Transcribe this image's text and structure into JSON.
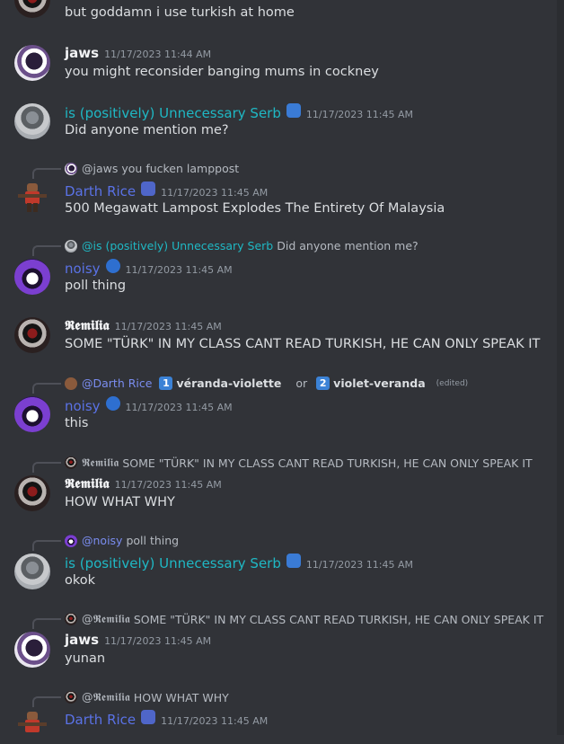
{
  "messages": [
    {
      "content": "but goddamn i use turkish at home"
    },
    {
      "author": "jaws",
      "timestamp": "11/17/2023 11:44 AM",
      "content": "you might reconsider banging mums in cockney"
    },
    {
      "author": "is (positively) Unnecessary Serb",
      "timestamp": "11/17/2023 11:45 AM",
      "content": "Did anyone mention me?"
    },
    {
      "reply_to": {
        "mention": "@jaws",
        "text": "you fucken lamppost"
      },
      "author": "Darth Rice",
      "timestamp": "11/17/2023 11:45 AM",
      "content": "500 Megawatt Lampost Explodes The Entirety Of Malaysia"
    },
    {
      "reply_to": {
        "mention": "@is (positively) Unnecessary Serb",
        "text": "Did anyone mention me?"
      },
      "author": "noisy",
      "timestamp": "11/17/2023 11:45 AM",
      "content": "poll thing"
    },
    {
      "author": "𝕽𝖊𝖒𝖎𝖑𝖎𝖆",
      "timestamp": "11/17/2023 11:45 AM",
      "content": "SOME \"TÜRK\" IN MY CLASS CANT READ TURKISH, HE CAN ONLY SPEAK IT"
    },
    {
      "reply_to": {
        "mention": "@Darth Rice",
        "poll": {
          "opt1_num": "1",
          "opt1": "véranda-violette",
          "or": "or",
          "opt2_num": "2",
          "opt2": "violet-veranda",
          "edited": "(edited)"
        }
      },
      "author": "noisy",
      "timestamp": "11/17/2023 11:45 AM",
      "content": "this"
    },
    {
      "reply_to": {
        "mention": "𝕽𝖊𝖒𝖎𝖑𝖎𝖆",
        "text": "SOME \"TÜRK\" IN MY CLASS CANT READ TURKISH, HE CAN ONLY SPEAK IT"
      },
      "author": "𝕽𝖊𝖒𝖎𝖑𝖎𝖆",
      "timestamp": "11/17/2023 11:45 AM",
      "content": "HOW WHAT WHY"
    },
    {
      "reply_to": {
        "mention": "@noisy",
        "text": "poll thing"
      },
      "author": "is (positively) Unnecessary Serb",
      "timestamp": "11/17/2023 11:45 AM",
      "content": "okok"
    },
    {
      "reply_to": {
        "mention": "@𝕽𝖊𝖒𝖎𝖑𝖎𝖆",
        "text": "SOME \"TÜRK\" IN MY CLASS CANT READ TURKISH, HE CAN ONLY SPEAK IT"
      },
      "author": "jaws",
      "timestamp": "11/17/2023 11:45 AM",
      "content": "yunan"
    },
    {
      "reply_to": {
        "mention": "@𝕽𝖊𝖒𝖎𝖑𝖎𝖆",
        "text": "HOW WHAT WHY"
      },
      "author": "Darth Rice",
      "timestamp": "11/17/2023 11:45 AM"
    }
  ],
  "colors": {
    "background": "#313338",
    "serb_name": "#1fb8c4",
    "darth_name": "#5a72e6",
    "timestamp": "#949ba4"
  }
}
